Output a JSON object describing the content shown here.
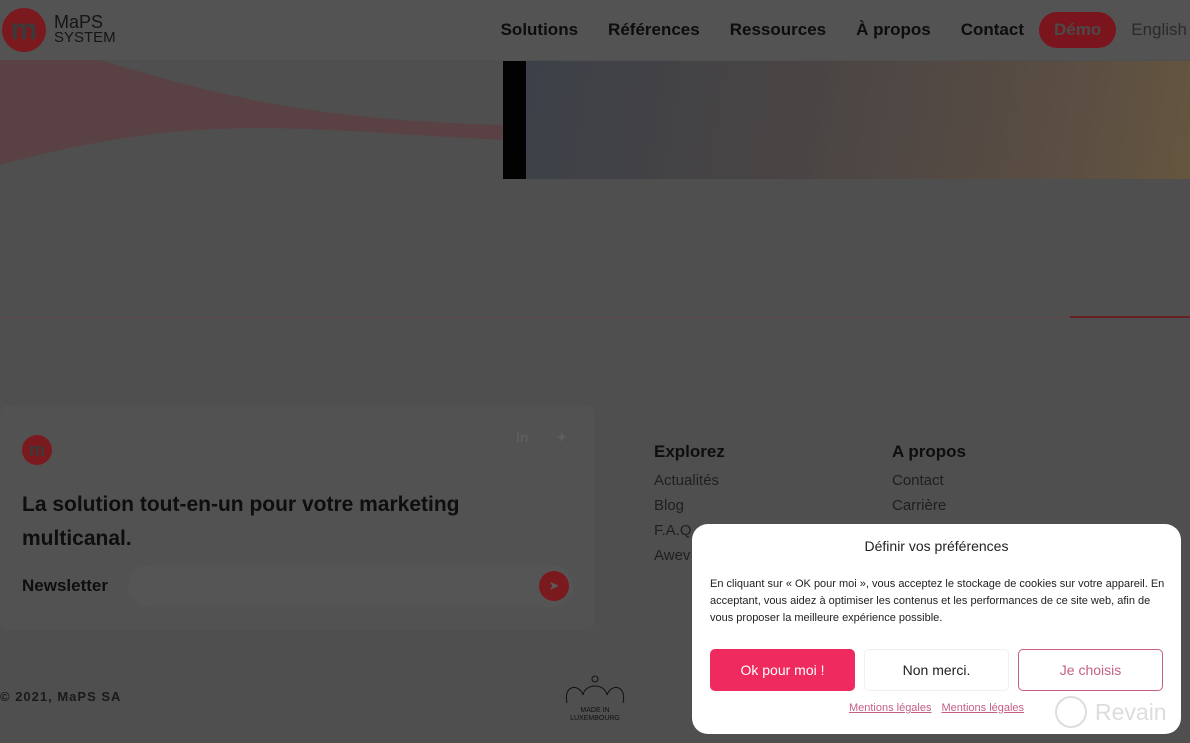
{
  "header": {
    "logo_line1": "MaPS",
    "logo_line2": "SYSTEM",
    "logo_letter": "m",
    "nav": [
      "Solutions",
      "Références",
      "Ressources",
      "À propos",
      "Contact"
    ],
    "demo": "Démo",
    "language": "English"
  },
  "footer": {
    "logo_letter": "m",
    "social": {
      "linkedin": "in",
      "twitter": "🐦"
    },
    "tagline": "La solution tout-en-un pour votre marketing multicanal.",
    "newsletter_label": "Newsletter",
    "send_icon": "paper-plane-icon",
    "explore": {
      "title": "Explorez",
      "items": [
        "Actualités",
        "Blog",
        "F.A.Q",
        "Awev"
      ]
    },
    "about": {
      "title": "A propos",
      "items": [
        "Contact",
        "Carrière"
      ]
    },
    "copyright": "© 2021, MaPS SA",
    "badge": "MADE IN LUXEMBOURG"
  },
  "cookie": {
    "title": "Définir vos préférences",
    "text": "En cliquant sur « OK pour moi », vous acceptez le stockage de cookies sur votre appareil. En acceptant, vous aidez à optimiser les contenus et les performances de ce site web, afin de vous proposer la meilleure expérience possible.",
    "ok": "Ok pour moi !",
    "no": "Non merci.",
    "choose": "Je choisis",
    "links": [
      "Mentions légales",
      "Mentions légales"
    ]
  },
  "watermark": "Revain",
  "colors": {
    "accent": "#ee2a5e",
    "brand": "#c8202a",
    "link": "#c45f87"
  }
}
